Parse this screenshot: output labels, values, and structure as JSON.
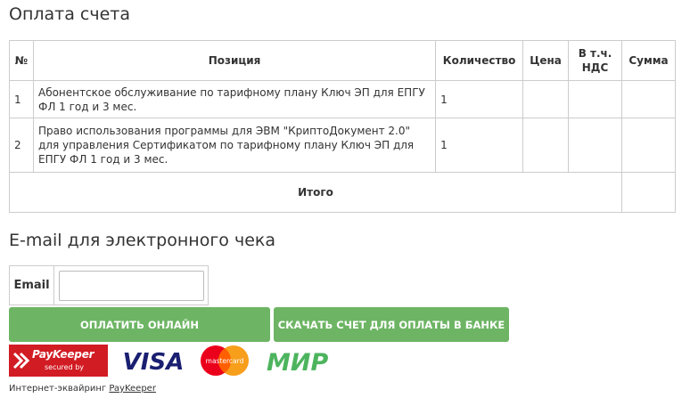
{
  "page_title": "Оплата счета",
  "table": {
    "headers": [
      "№",
      "Позиция",
      "Количество",
      "Цена",
      "В т.ч. НДС",
      "Сумма"
    ],
    "rows": [
      {
        "num": "1",
        "position": "Абонентское обслуживание по тарифному плану Ключ ЭП для ЕПГУ ФЛ 1 год и 3 мес.",
        "qty": "1",
        "price": "",
        "vat": "",
        "sum": ""
      },
      {
        "num": "2",
        "position": "Право использования программы для ЭВМ \"КриптоДокумент 2.0\" для управления Сертификатом по тарифному плану Ключ ЭП для ЕПГУ ФЛ 1 год и 3 мес.",
        "qty": "1",
        "price": "",
        "vat": "",
        "sum": ""
      }
    ],
    "total_label": "Итого",
    "total_value": ""
  },
  "email_section": {
    "heading": "E-mail для электронного чека",
    "label": "Email",
    "value": "",
    "placeholder": ""
  },
  "buttons": {
    "pay_online": "Оплатить онлайн",
    "download_invoice": "Скачать счет для оплаты в банке"
  },
  "logos": {
    "paykeeper_name": "PayKeeper",
    "paykeeper_secured": "secured by",
    "visa": "VISA",
    "mastercard": "mastercard",
    "mir": "МИР"
  },
  "footer": {
    "text": "Интернет-эквайринг",
    "link": "PayKeeper"
  },
  "colors": {
    "button_green": "#6db564",
    "paykeeper_red": "#d21c24",
    "visa_blue": "#1a1f71",
    "mir_green": "#4db45e"
  }
}
